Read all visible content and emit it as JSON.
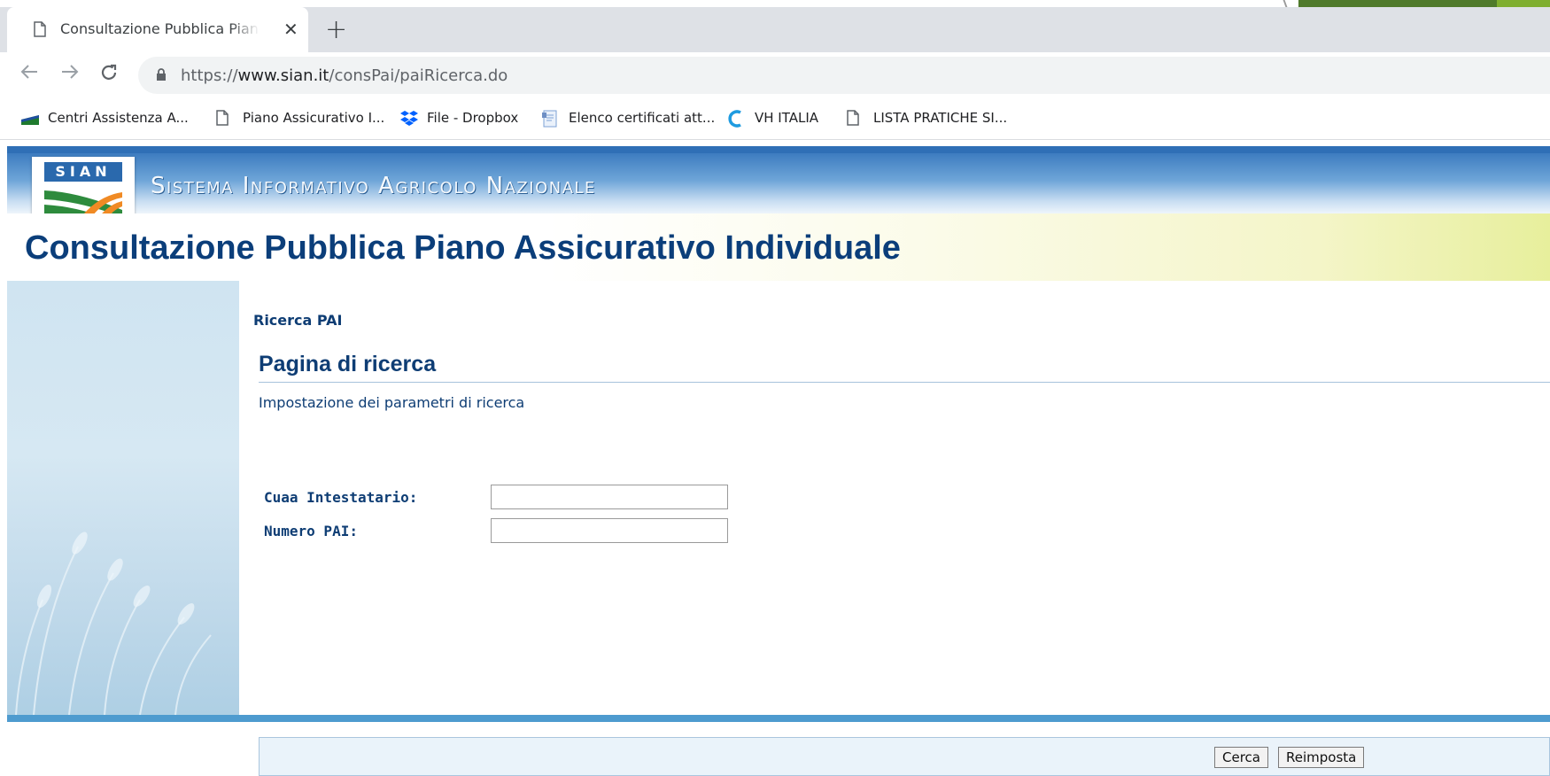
{
  "browser": {
    "tab_title": "Consultazione Pubblica Piano Assicurativo Individuale",
    "close_symbol": "✕",
    "new_tab_symbol": "+",
    "url_scheme": "https://",
    "url_host": "www.sian.it",
    "url_path": "/consPai/paiRicerca.do",
    "nav_icons": [
      "back-arrow-icon",
      "forward-arrow-icon",
      "reload-icon",
      "lock-icon"
    ]
  },
  "bookmarks": [
    {
      "label": "Centri Assistenza A...",
      "icon": "flag-icon"
    },
    {
      "label": "Piano Assicurativo I...",
      "icon": "page-icon"
    },
    {
      "label": "File - Dropbox",
      "icon": "dropbox-icon"
    },
    {
      "label": "Elenco certificati att...",
      "icon": "document-icon"
    },
    {
      "label": "VH ITALIA",
      "icon": "vh-logo-icon"
    },
    {
      "label": "LISTA PRATICHE SI...",
      "icon": "page-icon"
    }
  ],
  "site": {
    "logo_text": "SIAN",
    "system_name": "Sistema Informativo Agricolo Nazionale",
    "app_title": "Consultazione Pubblica Piano Assicurativo Individuale"
  },
  "page": {
    "breadcrumb": "Ricerca PAI",
    "title": "Pagina di ricerca",
    "subtitle": "Impostazione dei parametri di ricerca",
    "fields": [
      {
        "label": "Cuaa Intestatario:",
        "value": ""
      },
      {
        "label": "Numero PAI:",
        "value": ""
      }
    ],
    "buttons": {
      "search": "Cerca",
      "reset": "Reimposta"
    }
  },
  "colors": {
    "brand_blue": "#0b3e7a",
    "banner_blue": "#3d7cc0",
    "footer_blue": "#4e9bcf"
  }
}
